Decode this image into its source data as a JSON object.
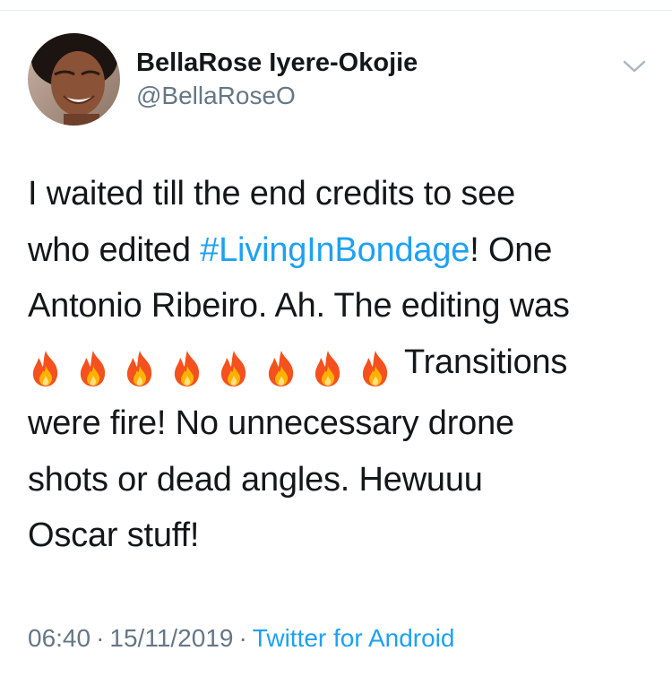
{
  "user": {
    "display_name": "BellaRose Iyere-Okojie",
    "handle": "@BellaRoseO"
  },
  "tweet": {
    "line1": "I waited till the end credits to see",
    "line2_prefix": "who edited ",
    "hashtag": "#LivingInBondage",
    "line2_suffix": "! One",
    "line3": "Antonio Ribeiro. Ah. The editing was",
    "fire_emoji_count": 8,
    "line4_suffix": "Transitions",
    "line5": "were fire! No unnecessary drone",
    "line6": "shots or dead angles. Hewuuu",
    "line7": "Oscar stuff!"
  },
  "meta": {
    "time": "06:40",
    "separator": "·",
    "date": "15/11/2019",
    "source": "Twitter for Android"
  },
  "colors": {
    "text": "#14171a",
    "secondary": "#657786",
    "link": "#1da1f2"
  },
  "icons": {
    "caret": "chevron-down-icon",
    "emoji": "fire-emoji-icon"
  }
}
